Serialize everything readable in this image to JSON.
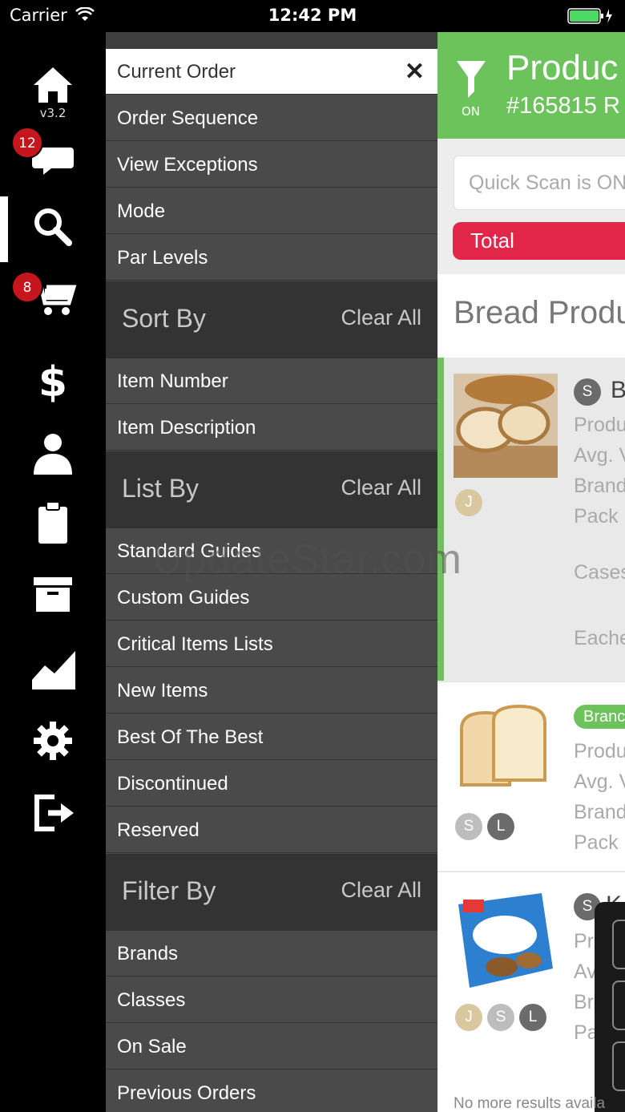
{
  "status_bar": {
    "carrier": "Carrier",
    "time": "12:42 PM"
  },
  "rail": {
    "version": "v3.2",
    "messages_badge": "12",
    "cart_badge": "8",
    "icons": [
      "home-icon",
      "chat-icon",
      "search-icon",
      "cart-icon",
      "dollar-icon",
      "user-icon",
      "clipboard-icon",
      "archive-icon",
      "chart-icon",
      "gear-icon",
      "logout-icon"
    ]
  },
  "drawer": {
    "top_items": [
      "Current Order",
      "Order Sequence",
      "View Exceptions",
      "Mode",
      "Par Levels"
    ],
    "sort_by": {
      "title": "Sort By",
      "clear": "Clear All",
      "items": [
        "Item Number",
        "Item Description"
      ]
    },
    "list_by": {
      "title": "List By",
      "clear": "Clear All",
      "items": [
        "Standard Guides",
        "Custom Guides",
        "Critical Items Lists",
        "New Items",
        "Best Of The Best",
        "Discontinued",
        "Reserved"
      ]
    },
    "filter_by": {
      "title": "Filter By",
      "clear": "Clear All",
      "items": [
        "Brands",
        "Classes",
        "On Sale",
        "Previous Orders"
      ]
    }
  },
  "content": {
    "header_title": "Produc",
    "header_sub": "#165815 R",
    "filter_state": "ON",
    "search_placeholder": "Quick Scan is ON",
    "total_label": "Total",
    "category_title": "Bread Produ",
    "products": [
      {
        "initial_badge": "S",
        "initial_text": "B",
        "lines": [
          "Produ",
          "Avg. V",
          "Brand",
          "Pack",
          "Cases",
          "Eache"
        ],
        "tags": [
          "J"
        ]
      },
      {
        "brand_label": "Branc",
        "lines": [
          "Produ",
          "Avg. V",
          "Brand",
          "Pack"
        ],
        "tags": [
          "S",
          "L"
        ]
      },
      {
        "initial_badge": "S",
        "initial_text": "K",
        "lines": [
          "Produ",
          "Avg.",
          "Bra",
          "Pack"
        ],
        "tags": [
          "J",
          "S",
          "L"
        ]
      }
    ],
    "footer_text": "No more results availa"
  },
  "watermark": "UpdateStar.com",
  "colors": {
    "green": "#6cc35b",
    "red": "#e2264a",
    "badge_red": "#c4161c",
    "drawer_bg": "#4a4a4a",
    "section_bg": "#333333"
  }
}
